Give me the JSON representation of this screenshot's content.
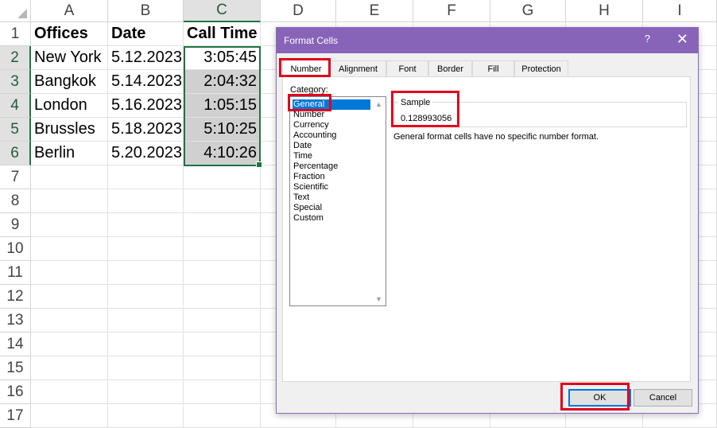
{
  "columns": [
    "A",
    "B",
    "C",
    "D",
    "E",
    "F",
    "G",
    "H",
    "I"
  ],
  "rows": [
    "1",
    "2",
    "3",
    "4",
    "5",
    "6",
    "7",
    "8",
    "9",
    "10",
    "11",
    "12",
    "13",
    "14",
    "15",
    "16",
    "17"
  ],
  "table": {
    "headers": [
      "Offices",
      "Date",
      "Call Time"
    ],
    "data": [
      [
        "New York",
        "5.12.2023",
        "3:05:45"
      ],
      [
        "Bangkok",
        "5.14.2023",
        "2:04:32"
      ],
      [
        "London",
        "5.16.2023",
        "1:05:15"
      ],
      [
        "Brussles",
        "5.18.2023",
        "5:10:25"
      ],
      [
        "Berlin",
        "5.20.2023",
        "4:10:26"
      ]
    ]
  },
  "dialog": {
    "title": "Format Cells",
    "help": "?",
    "close": "✕",
    "tabs": [
      "Number",
      "Alignment",
      "Font",
      "Border",
      "Fill",
      "Protection"
    ],
    "category_label": "Category:",
    "categories": [
      "General",
      "Number",
      "Currency",
      "Accounting",
      "Date",
      "Time",
      "Percentage",
      "Fraction",
      "Scientific",
      "Text",
      "Special",
      "Custom"
    ],
    "selected_category": "General",
    "sample_label": "Sample",
    "sample_value": "0.128993056",
    "description": "General format cells have no specific number format.",
    "ok": "OK",
    "cancel": "Cancel"
  },
  "colors": {
    "accent_green": "#217346",
    "dialog_title": "#8764b8",
    "selection_blue": "#0078d7",
    "highlight_red": "#e0001b"
  }
}
